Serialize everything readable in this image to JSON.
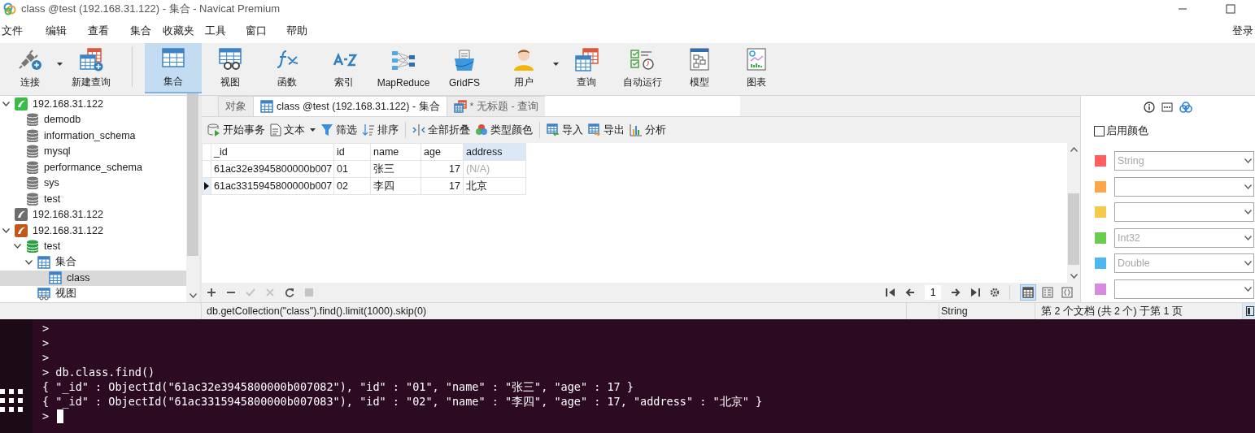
{
  "window": {
    "title": "class @test (192.168.31.122) - 集合 - Navicat Premium"
  },
  "menu": {
    "items": [
      "文件",
      "编辑",
      "查看",
      "集合",
      "收藏夹",
      "工具",
      "窗口",
      "帮助"
    ],
    "login": "登录"
  },
  "toolbar": {
    "groups": [
      [
        {
          "label": "连接",
          "selected": false,
          "dropdown": true
        },
        {
          "label": "新建查询",
          "selected": false,
          "dropdown": false
        }
      ],
      [
        {
          "label": "集合",
          "selected": true,
          "dropdown": false
        },
        {
          "label": "视图",
          "selected": false,
          "dropdown": false
        },
        {
          "label": "函数",
          "selected": false,
          "dropdown": false
        },
        {
          "label": "索引",
          "selected": false,
          "dropdown": false
        },
        {
          "label": "MapReduce",
          "selected": false,
          "dropdown": false
        },
        {
          "label": "GridFS",
          "selected": false,
          "dropdown": false
        },
        {
          "label": "用户",
          "selected": false,
          "dropdown": true
        },
        {
          "label": "查询",
          "selected": false,
          "dropdown": false
        },
        {
          "label": "自动运行",
          "selected": false,
          "dropdown": false
        },
        {
          "label": "模型",
          "selected": false,
          "dropdown": false
        },
        {
          "label": "图表",
          "selected": false,
          "dropdown": false
        }
      ]
    ]
  },
  "tree": [
    {
      "label": "192.168.31.122",
      "kind": "connection",
      "color": "#3dbb4a",
      "expanded": true,
      "selected": false,
      "children": [
        {
          "label": "demodb",
          "kind": "database",
          "selected": false
        },
        {
          "label": "information_schema",
          "kind": "database",
          "selected": false
        },
        {
          "label": "mysql",
          "kind": "database",
          "selected": false
        },
        {
          "label": "performance_schema",
          "kind": "database",
          "selected": false
        },
        {
          "label": "sys",
          "kind": "database",
          "selected": false
        },
        {
          "label": "test",
          "kind": "database",
          "selected": false
        }
      ]
    },
    {
      "label": "192.168.31.122",
      "kind": "connection",
      "color": "#6d6d6d",
      "selected": false
    },
    {
      "label": "192.168.31.122",
      "kind": "connection",
      "color": "#c2571a",
      "expanded": true,
      "selected": false,
      "children": [
        {
          "label": "test",
          "kind": "open-database",
          "expanded": true,
          "selected": false,
          "children": [
            {
              "label": "集合",
              "kind": "collections",
              "expanded": true,
              "selected": false,
              "children": [
                {
                  "label": "class",
                  "kind": "collection",
                  "selected": true
                }
              ]
            },
            {
              "label": "视图",
              "kind": "views",
              "selected": false
            }
          ]
        }
      ]
    }
  ],
  "tabs": [
    {
      "label": "对象",
      "selected": false
    },
    {
      "label": "class @test (192.168.31.122) - 集合",
      "selected": true
    },
    {
      "label": "* 无标题 - 查询",
      "selected": false
    }
  ],
  "data_toolbar": {
    "groups": [
      [
        {
          "label": "开始事务",
          "dropdown": false
        },
        {
          "label": "文本",
          "dropdown": true
        },
        {
          "label": "筛选",
          "dropdown": false
        },
        {
          "label": "排序",
          "dropdown": false
        }
      ],
      [
        {
          "label": "全部折叠",
          "dropdown": false
        },
        {
          "label": "类型颜色",
          "dropdown": false
        }
      ],
      [
        {
          "label": "导入",
          "dropdown": false
        },
        {
          "label": "导出",
          "dropdown": false
        },
        {
          "label": "分析",
          "dropdown": false
        }
      ]
    ]
  },
  "grid": {
    "columns": [
      {
        "label": "_id",
        "selected": false
      },
      {
        "label": "id",
        "selected": false
      },
      {
        "label": "name",
        "selected": false
      },
      {
        "label": "age",
        "selected": false
      },
      {
        "label": "address",
        "selected": true
      }
    ],
    "rows": [
      {
        "selected": false,
        "cells": [
          {
            "text": "61ac32e3945800000b007",
            "kind": "text"
          },
          {
            "text": "01",
            "kind": "text"
          },
          {
            "text": "张三",
            "kind": "text"
          },
          {
            "text": "17",
            "kind": "number"
          },
          {
            "text": "(N/A)",
            "kind": "null"
          }
        ]
      },
      {
        "selected": true,
        "cells": [
          {
            "text": "61ac3315945800000b007",
            "kind": "text"
          },
          {
            "text": "02",
            "kind": "text"
          },
          {
            "text": "李四",
            "kind": "text"
          },
          {
            "text": "17",
            "kind": "number"
          },
          {
            "text": "北京",
            "kind": "text"
          }
        ]
      }
    ]
  },
  "grid_bar": {
    "edit_buttons": [
      {
        "disabled": false
      },
      {
        "disabled": false
      },
      {
        "disabled": true
      },
      {
        "disabled": true
      },
      {
        "disabled": false
      },
      {
        "disabled": true
      }
    ],
    "page": "1",
    "view_modes": [
      {
        "selected": true
      },
      {
        "selected": false
      },
      {
        "selected": false
      }
    ]
  },
  "side_panel": {
    "enable_color": {
      "label": "启用颜色",
      "checked": false
    },
    "type_colors": [
      {
        "color": "#ff5f5f",
        "type": "String"
      },
      {
        "color": "#ffa449"
      },
      {
        "color": "#f5c94c"
      },
      {
        "color": "#6ccc52",
        "type": "Int32"
      },
      {
        "color": "#4db7f0",
        "type": "Double"
      },
      {
        "color": "#d88ae0"
      }
    ]
  },
  "status_bar": {
    "query": "db.getCollection(\"class\").find().limit(1000).skip(0)",
    "type": "String",
    "record_info": "第 2 个文档 (共 2 个) 于第 1 页"
  },
  "terminal": {
    "lines": [
      ">",
      ">",
      ">",
      "> db.class.find()",
      "{ \"_id\" : ObjectId(\"61ac32e3945800000b007082\"), \"id\" : \"01\", \"name\" : \"张三\", \"age\" : 17 }",
      "{ \"_id\" : ObjectId(\"61ac3315945800000b007083\"), \"id\" : \"02\", \"name\" : \"李四\", \"age\" : 17, \"address\" : \"北京\" }"
    ],
    "prompt": ">"
  }
}
